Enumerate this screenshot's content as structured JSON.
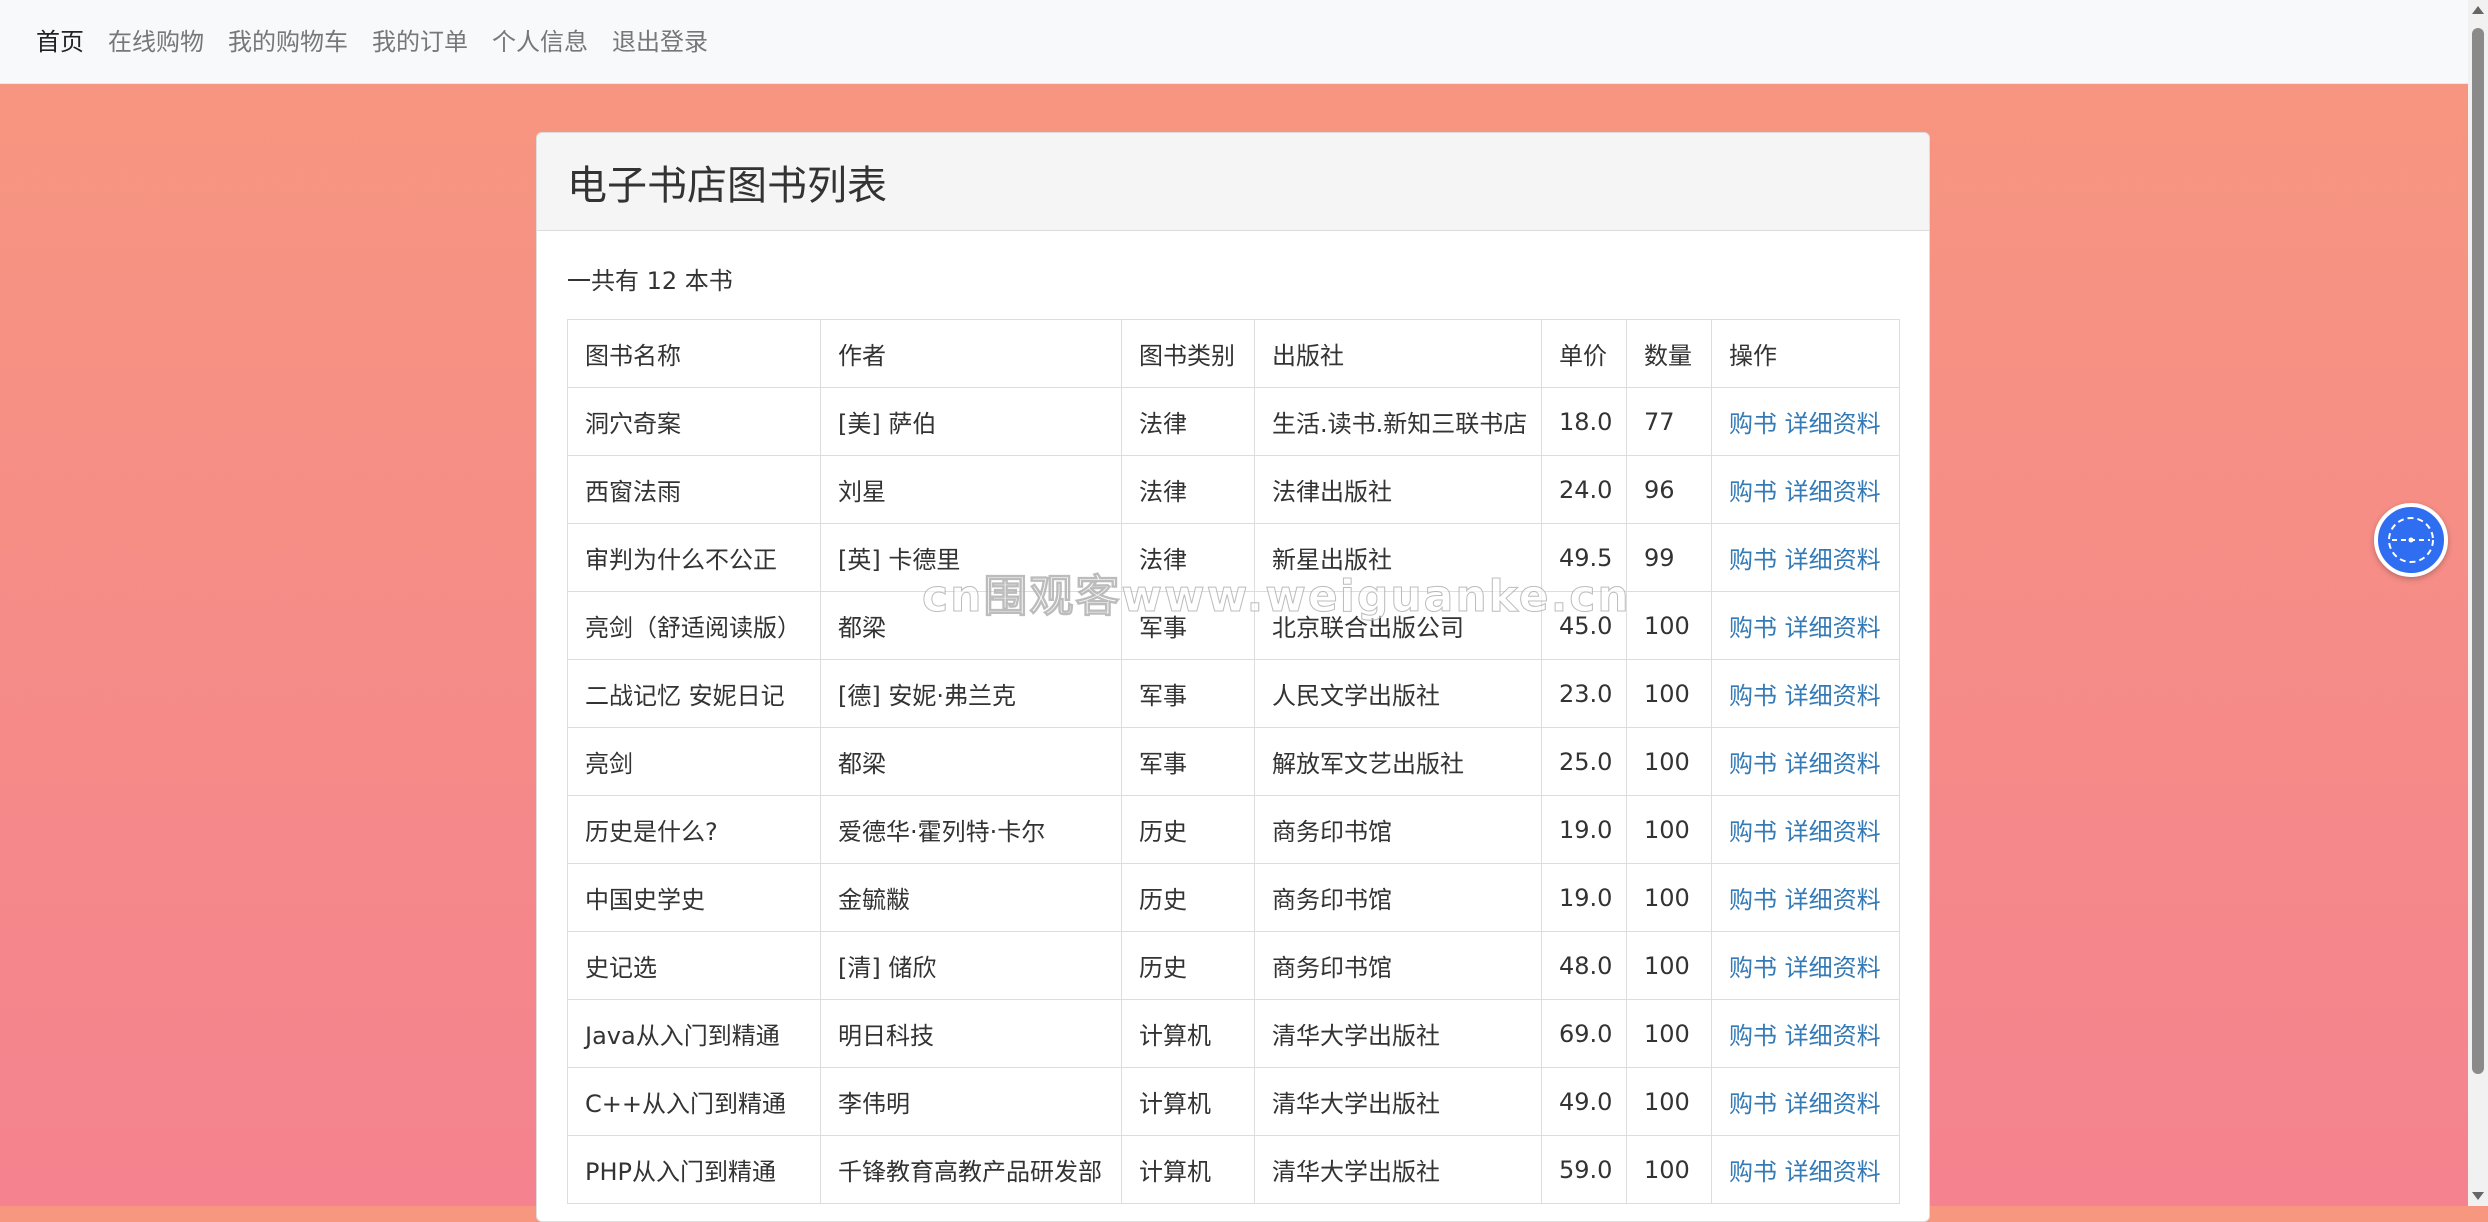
{
  "nav": [
    {
      "label": "首页",
      "active": true
    },
    {
      "label": "在线购物",
      "active": false
    },
    {
      "label": "我的购物车",
      "active": false
    },
    {
      "label": "我的订单",
      "active": false
    },
    {
      "label": "个人信息",
      "active": false
    },
    {
      "label": "退出登录",
      "active": false
    }
  ],
  "panel": {
    "title": "电子书店图书列表",
    "summary": "一共有 12 本书"
  },
  "table": {
    "columns": [
      "图书名称",
      "作者",
      "图书类别",
      "出版社",
      "单价",
      "数量",
      "操作"
    ],
    "action_buy": "购书",
    "action_detail": "详细资料",
    "rows": [
      {
        "name": "洞穴奇案",
        "author": "[美] 萨伯",
        "category": "法律",
        "publisher": "生活.读书.新知三联书店",
        "price": "18.0",
        "qty": "77"
      },
      {
        "name": "西窗法雨",
        "author": "刘星",
        "category": "法律",
        "publisher": "法律出版社",
        "price": "24.0",
        "qty": "96"
      },
      {
        "name": "审判为什么不公正",
        "author": "[英] 卡德里",
        "category": "法律",
        "publisher": "新星出版社",
        "price": "49.5",
        "qty": "99"
      },
      {
        "name": "亮剑（舒适阅读版）",
        "author": "都梁",
        "category": "军事",
        "publisher": "北京联合出版公司",
        "price": "45.0",
        "qty": "100"
      },
      {
        "name": "二战记忆 安妮日记",
        "author": "[德] 安妮·弗兰克",
        "category": "军事",
        "publisher": "人民文学出版社",
        "price": "23.0",
        "qty": "100"
      },
      {
        "name": "亮剑",
        "author": "都梁",
        "category": "军事",
        "publisher": "解放军文艺出版社",
        "price": "25.0",
        "qty": "100"
      },
      {
        "name": "历史是什么?",
        "author": "爱德华·霍列特·卡尔",
        "category": "历史",
        "publisher": "商务印书馆",
        "price": "19.0",
        "qty": "100"
      },
      {
        "name": "中国史学史",
        "author": "金毓黻",
        "category": "历史",
        "publisher": "商务印书馆",
        "price": "19.0",
        "qty": "100"
      },
      {
        "name": "史记选",
        "author": "[清] 储欣",
        "category": "历史",
        "publisher": "商务印书馆",
        "price": "48.0",
        "qty": "100"
      },
      {
        "name": "Java从入门到精通",
        "author": "明日科技",
        "category": "计算机",
        "publisher": "清华大学出版社",
        "price": "69.0",
        "qty": "100"
      },
      {
        "name": "C++从入门到精通",
        "author": "李伟明",
        "category": "计算机",
        "publisher": "清华大学出版社",
        "price": "49.0",
        "qty": "100"
      },
      {
        "name": "PHP从入门到精通",
        "author": "千锋教育高教产品研发部",
        "category": "计算机",
        "publisher": "清华大学出版社",
        "price": "59.0",
        "qty": "100"
      }
    ]
  },
  "watermark": "cn围观客www.weiguanke.cn",
  "float_button": {
    "icon": "compass-icon"
  }
}
